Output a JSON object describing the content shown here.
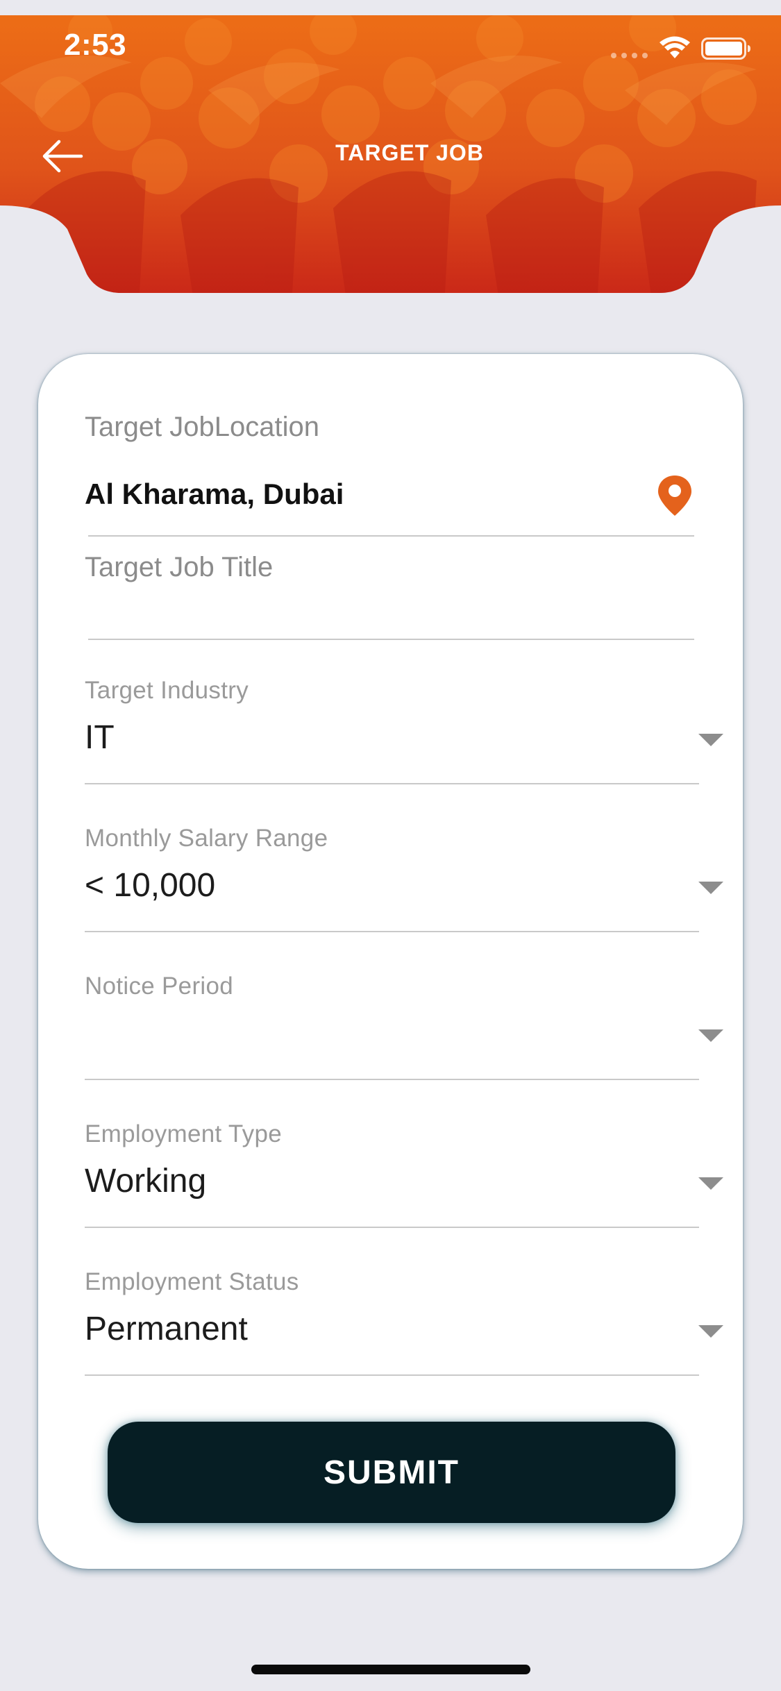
{
  "status_bar": {
    "time": "2:53"
  },
  "header": {
    "title": "TARGET JOB",
    "back_icon": "arrow-left-icon",
    "background_color": "#e4621c"
  },
  "form": {
    "location": {
      "label": "Target JobLocation",
      "value": "Al Kharama, Dubai",
      "icon": "map-pin-icon"
    },
    "job_title": {
      "label": "Target Job Title",
      "value": ""
    },
    "industry": {
      "label": "Target Industry",
      "value": "IT"
    },
    "salary": {
      "label": "Monthly Salary Range",
      "value": "< 10,000"
    },
    "notice": {
      "label": "Notice Period",
      "value": ""
    },
    "employment_type": {
      "label": "Employment Type",
      "value": "Working"
    },
    "employment_status": {
      "label": "Employment Status",
      "value": "Permanent"
    },
    "submit_label": "SUBMIT"
  },
  "colors": {
    "accent": "#e4621c",
    "button": "#061e24",
    "background": "#e9e9ef"
  }
}
